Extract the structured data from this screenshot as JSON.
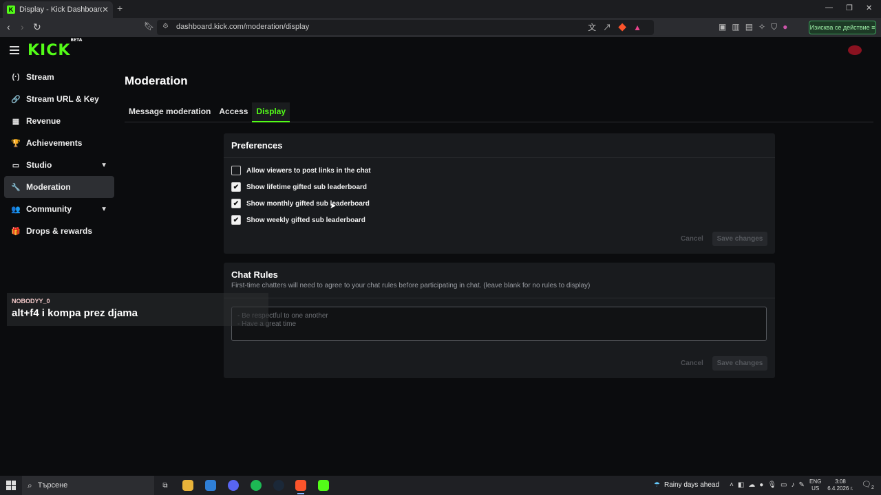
{
  "browser": {
    "tab_title": "Display - Kick Dashboard",
    "tab_favicon": "K",
    "new_tab": "+",
    "url": "dashboard.kick.com/moderation/display",
    "vpn_label": "Изисква се действие"
  },
  "app": {
    "logo": "KICK",
    "logo_badge": "BETA"
  },
  "sidebar": {
    "items": [
      {
        "label": "Stream",
        "icon": "(·)"
      },
      {
        "label": "Stream URL & Key",
        "icon": "🔗"
      },
      {
        "label": "Revenue",
        "icon": "▦"
      },
      {
        "label": "Achievements",
        "icon": "🏆"
      },
      {
        "label": "Studio",
        "icon": "▭"
      },
      {
        "label": "Moderation",
        "icon": "🔧"
      },
      {
        "label": "Community",
        "icon": "👥"
      },
      {
        "label": "Drops & rewards",
        "icon": "🎁"
      }
    ]
  },
  "main": {
    "title": "Moderation",
    "tabs": [
      {
        "label": "Message moderation"
      },
      {
        "label": "Access"
      },
      {
        "label": "Display"
      }
    ],
    "active_tab": "Display"
  },
  "preferences": {
    "title": "Preferences",
    "options": [
      {
        "label": "Allow viewers to post links in the chat",
        "checked": false
      },
      {
        "label": "Show lifetime gifted sub leaderboard",
        "checked": true
      },
      {
        "label": "Show monthly gifted sub leaderboard",
        "checked": true
      },
      {
        "label": "Show weekly gifted sub leaderboard",
        "checked": true
      }
    ],
    "cancel_label": "Cancel",
    "save_label": "Save changes"
  },
  "chat_rules": {
    "title": "Chat Rules",
    "description": "First-time chatters will need to agree to your chat rules before participating in chat. (leave blank for no rules to display)",
    "placeholder_line1": "- Be respectful to one another",
    "placeholder_line2": "- Have a great time",
    "cancel_label": "Cancel",
    "save_label": "Save changes"
  },
  "overlay": {
    "username": "NOBODYY_0",
    "message": "alt+f4 i kompa prez djama"
  },
  "taskbar": {
    "search_placeholder": "Търсене",
    "weather": "Rainy days ahead",
    "lang_top": "ENG",
    "lang_bottom": "US",
    "time": "3:08",
    "date": "6.4.2026 г.",
    "notification_count": "2"
  },
  "colors": {
    "accent": "#53fc18",
    "background": "#0b0c0e",
    "card": "#191b1e"
  }
}
